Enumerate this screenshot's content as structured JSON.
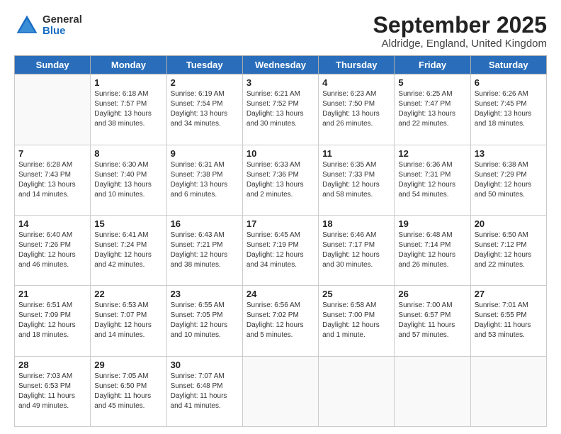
{
  "header": {
    "logo": {
      "general": "General",
      "blue": "Blue"
    },
    "title": "September 2025",
    "subtitle": "Aldridge, England, United Kingdom"
  },
  "calendar": {
    "days_of_week": [
      "Sunday",
      "Monday",
      "Tuesday",
      "Wednesday",
      "Thursday",
      "Friday",
      "Saturday"
    ],
    "weeks": [
      [
        {
          "day": "",
          "sunrise": "",
          "sunset": "",
          "daylight": "",
          "empty": true
        },
        {
          "day": "1",
          "sunrise": "Sunrise: 6:18 AM",
          "sunset": "Sunset: 7:57 PM",
          "daylight": "Daylight: 13 hours and 38 minutes."
        },
        {
          "day": "2",
          "sunrise": "Sunrise: 6:19 AM",
          "sunset": "Sunset: 7:54 PM",
          "daylight": "Daylight: 13 hours and 34 minutes."
        },
        {
          "day": "3",
          "sunrise": "Sunrise: 6:21 AM",
          "sunset": "Sunset: 7:52 PM",
          "daylight": "Daylight: 13 hours and 30 minutes."
        },
        {
          "day": "4",
          "sunrise": "Sunrise: 6:23 AM",
          "sunset": "Sunset: 7:50 PM",
          "daylight": "Daylight: 13 hours and 26 minutes."
        },
        {
          "day": "5",
          "sunrise": "Sunrise: 6:25 AM",
          "sunset": "Sunset: 7:47 PM",
          "daylight": "Daylight: 13 hours and 22 minutes."
        },
        {
          "day": "6",
          "sunrise": "Sunrise: 6:26 AM",
          "sunset": "Sunset: 7:45 PM",
          "daylight": "Daylight: 13 hours and 18 minutes."
        }
      ],
      [
        {
          "day": "7",
          "sunrise": "Sunrise: 6:28 AM",
          "sunset": "Sunset: 7:43 PM",
          "daylight": "Daylight: 13 hours and 14 minutes."
        },
        {
          "day": "8",
          "sunrise": "Sunrise: 6:30 AM",
          "sunset": "Sunset: 7:40 PM",
          "daylight": "Daylight: 13 hours and 10 minutes."
        },
        {
          "day": "9",
          "sunrise": "Sunrise: 6:31 AM",
          "sunset": "Sunset: 7:38 PM",
          "daylight": "Daylight: 13 hours and 6 minutes."
        },
        {
          "day": "10",
          "sunrise": "Sunrise: 6:33 AM",
          "sunset": "Sunset: 7:36 PM",
          "daylight": "Daylight: 13 hours and 2 minutes."
        },
        {
          "day": "11",
          "sunrise": "Sunrise: 6:35 AM",
          "sunset": "Sunset: 7:33 PM",
          "daylight": "Daylight: 12 hours and 58 minutes."
        },
        {
          "day": "12",
          "sunrise": "Sunrise: 6:36 AM",
          "sunset": "Sunset: 7:31 PM",
          "daylight": "Daylight: 12 hours and 54 minutes."
        },
        {
          "day": "13",
          "sunrise": "Sunrise: 6:38 AM",
          "sunset": "Sunset: 7:29 PM",
          "daylight": "Daylight: 12 hours and 50 minutes."
        }
      ],
      [
        {
          "day": "14",
          "sunrise": "Sunrise: 6:40 AM",
          "sunset": "Sunset: 7:26 PM",
          "daylight": "Daylight: 12 hours and 46 minutes."
        },
        {
          "day": "15",
          "sunrise": "Sunrise: 6:41 AM",
          "sunset": "Sunset: 7:24 PM",
          "daylight": "Daylight: 12 hours and 42 minutes."
        },
        {
          "day": "16",
          "sunrise": "Sunrise: 6:43 AM",
          "sunset": "Sunset: 7:21 PM",
          "daylight": "Daylight: 12 hours and 38 minutes."
        },
        {
          "day": "17",
          "sunrise": "Sunrise: 6:45 AM",
          "sunset": "Sunset: 7:19 PM",
          "daylight": "Daylight: 12 hours and 34 minutes."
        },
        {
          "day": "18",
          "sunrise": "Sunrise: 6:46 AM",
          "sunset": "Sunset: 7:17 PM",
          "daylight": "Daylight: 12 hours and 30 minutes."
        },
        {
          "day": "19",
          "sunrise": "Sunrise: 6:48 AM",
          "sunset": "Sunset: 7:14 PM",
          "daylight": "Daylight: 12 hours and 26 minutes."
        },
        {
          "day": "20",
          "sunrise": "Sunrise: 6:50 AM",
          "sunset": "Sunset: 7:12 PM",
          "daylight": "Daylight: 12 hours and 22 minutes."
        }
      ],
      [
        {
          "day": "21",
          "sunrise": "Sunrise: 6:51 AM",
          "sunset": "Sunset: 7:09 PM",
          "daylight": "Daylight: 12 hours and 18 minutes."
        },
        {
          "day": "22",
          "sunrise": "Sunrise: 6:53 AM",
          "sunset": "Sunset: 7:07 PM",
          "daylight": "Daylight: 12 hours and 14 minutes."
        },
        {
          "day": "23",
          "sunrise": "Sunrise: 6:55 AM",
          "sunset": "Sunset: 7:05 PM",
          "daylight": "Daylight: 12 hours and 10 minutes."
        },
        {
          "day": "24",
          "sunrise": "Sunrise: 6:56 AM",
          "sunset": "Sunset: 7:02 PM",
          "daylight": "Daylight: 12 hours and 5 minutes."
        },
        {
          "day": "25",
          "sunrise": "Sunrise: 6:58 AM",
          "sunset": "Sunset: 7:00 PM",
          "daylight": "Daylight: 12 hours and 1 minute."
        },
        {
          "day": "26",
          "sunrise": "Sunrise: 7:00 AM",
          "sunset": "Sunset: 6:57 PM",
          "daylight": "Daylight: 11 hours and 57 minutes."
        },
        {
          "day": "27",
          "sunrise": "Sunrise: 7:01 AM",
          "sunset": "Sunset: 6:55 PM",
          "daylight": "Daylight: 11 hours and 53 minutes."
        }
      ],
      [
        {
          "day": "28",
          "sunrise": "Sunrise: 7:03 AM",
          "sunset": "Sunset: 6:53 PM",
          "daylight": "Daylight: 11 hours and 49 minutes."
        },
        {
          "day": "29",
          "sunrise": "Sunrise: 7:05 AM",
          "sunset": "Sunset: 6:50 PM",
          "daylight": "Daylight: 11 hours and 45 minutes."
        },
        {
          "day": "30",
          "sunrise": "Sunrise: 7:07 AM",
          "sunset": "Sunset: 6:48 PM",
          "daylight": "Daylight: 11 hours and 41 minutes."
        },
        {
          "day": "",
          "sunrise": "",
          "sunset": "",
          "daylight": "",
          "empty": true
        },
        {
          "day": "",
          "sunrise": "",
          "sunset": "",
          "daylight": "",
          "empty": true
        },
        {
          "day": "",
          "sunrise": "",
          "sunset": "",
          "daylight": "",
          "empty": true
        },
        {
          "day": "",
          "sunrise": "",
          "sunset": "",
          "daylight": "",
          "empty": true
        }
      ]
    ]
  }
}
